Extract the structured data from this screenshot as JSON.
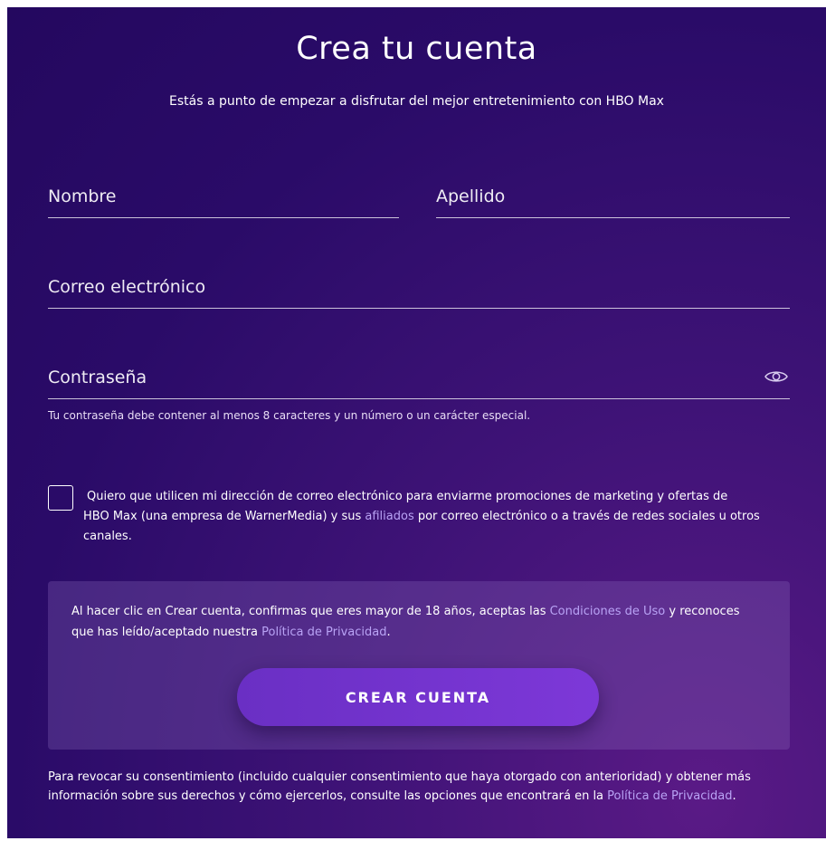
{
  "header": {
    "title": "Crea tu cuenta",
    "subtitle": "Estás a punto de empezar a disfrutar del mejor entretenimiento con HBO Max"
  },
  "form": {
    "first_name": {
      "value": "",
      "placeholder": "Nombre"
    },
    "last_name": {
      "value": "",
      "placeholder": "Apellido"
    },
    "email": {
      "value": "",
      "placeholder": "Correo electrónico"
    },
    "password": {
      "value": "",
      "placeholder": "Contraseña",
      "toggle_icon": "eye-icon"
    },
    "password_hint": "Tu contraseña debe contener al menos 8 caracteres y un número o un carácter especial."
  },
  "marketing": {
    "checked": false,
    "text_1": "Quiero que utilicen mi dirección de correo electrónico para enviarme promociones de marketing y ofertas de",
    "text_2": "HBO Max (una empresa de WarnerMedia) y sus ",
    "link_affiliates": "afiliados",
    "text_3": " por correo electrónico o a través de redes sociales u otros canales."
  },
  "terms": {
    "text_1": "Al hacer clic en Crear cuenta, confirmas que eres mayor de 18 años, aceptas las ",
    "link_terms": "Condiciones de Uso",
    "text_2": " y reconoces que has leído/aceptado nuestra ",
    "link_privacy": "Política de Privacidad",
    "text_3": ".",
    "button_label": "CREAR CUENTA"
  },
  "footer": {
    "text": "Para revocar su consentimiento (incluido cualquier consentimiento que haya otorgado con anterioridad) y obtener más información sobre sus derechos y cómo ejercerlos, consulte las opciones que encontrará en la ",
    "link_privacy": "Política de Privacidad",
    "end": "."
  },
  "colors": {
    "background": "#2a0b68",
    "accent": "#7d38d8",
    "link": "#b9a3f5"
  }
}
